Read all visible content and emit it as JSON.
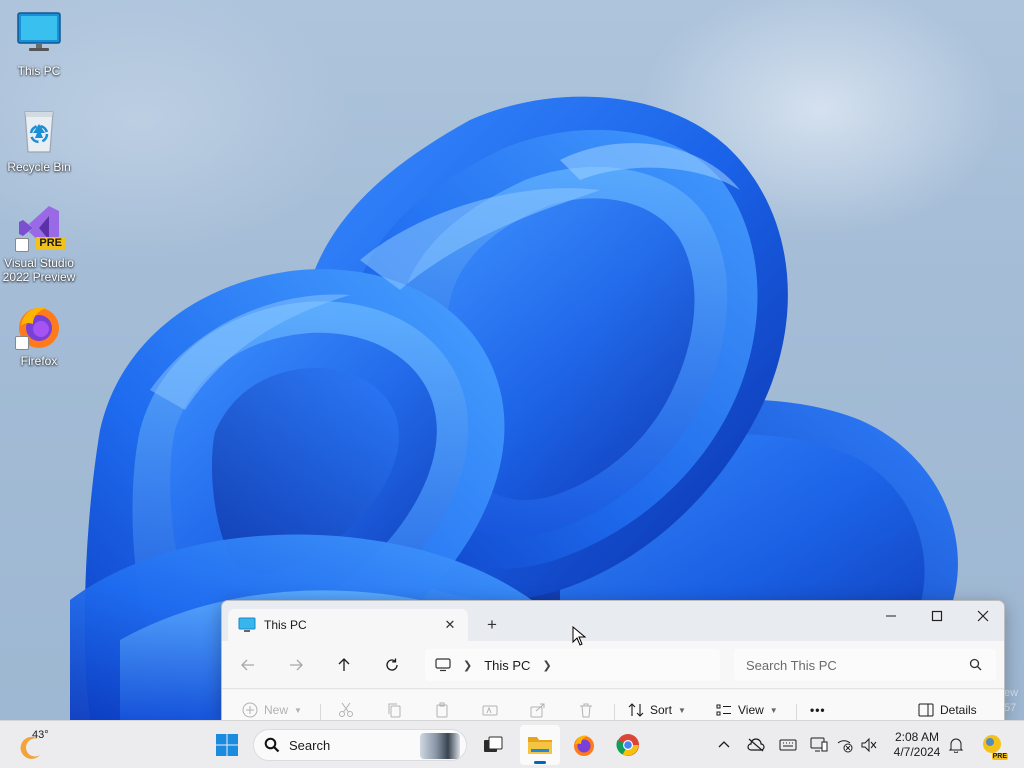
{
  "desktop": {
    "icons": [
      {
        "label": "This PC"
      },
      {
        "label": "Recycle Bin"
      },
      {
        "label": "Visual Studio 2022 Preview",
        "badge": "PRE"
      },
      {
        "label": "Firefox"
      }
    ],
    "watermark_lines": [
      "ew",
      "57"
    ]
  },
  "explorer": {
    "tab": {
      "label": "This PC",
      "icon": "monitor-icon"
    },
    "address": {
      "crumbs": [
        "This PC"
      ]
    },
    "search": {
      "placeholder": "Search This PC"
    },
    "commands": {
      "new_label": "New",
      "sort_label": "Sort",
      "view_label": "View",
      "more_label": "•••",
      "details_label": "Details"
    }
  },
  "taskbar": {
    "weather": {
      "temp": "43°"
    },
    "search": {
      "placeholder": "Search"
    },
    "clock": {
      "time": "2:08 AM",
      "date": "4/7/2024"
    },
    "tray_badge": "PRE",
    "pinned": [
      "start",
      "search",
      "task-view",
      "file-explorer",
      "firefox",
      "chrome"
    ]
  },
  "colors": {
    "accent": "#0067c0",
    "bloom_blue": "#1560e6",
    "taskbar_bg": "#ececef"
  }
}
